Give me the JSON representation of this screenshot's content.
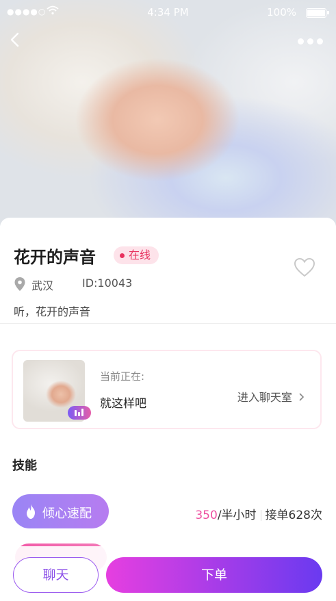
{
  "status_bar": {
    "signal": "●●●●○",
    "time": "4:34 PM",
    "battery": "100%"
  },
  "nav": {
    "back_icon": "chevron-left-icon",
    "more_icon": "more-dots-icon"
  },
  "profile": {
    "name": "花开的声音",
    "status": "在线",
    "city": "武汉",
    "id": "ID:10043",
    "bio": "听，花开的声音"
  },
  "room": {
    "label": "当前正在:",
    "song": "就这样吧",
    "enter": "进入聊天室"
  },
  "skills": {
    "title": "技能",
    "items": [
      {
        "name": "倾心速配",
        "price": "350",
        "unit": "/半小时",
        "orders": "接单628次"
      }
    ]
  },
  "actions": {
    "chat": "聊天",
    "order": "下单"
  },
  "colors": {
    "accent_purple": "#8a4ee8",
    "accent_pink": "#ee4fa0",
    "online_red": "#e8325f"
  }
}
